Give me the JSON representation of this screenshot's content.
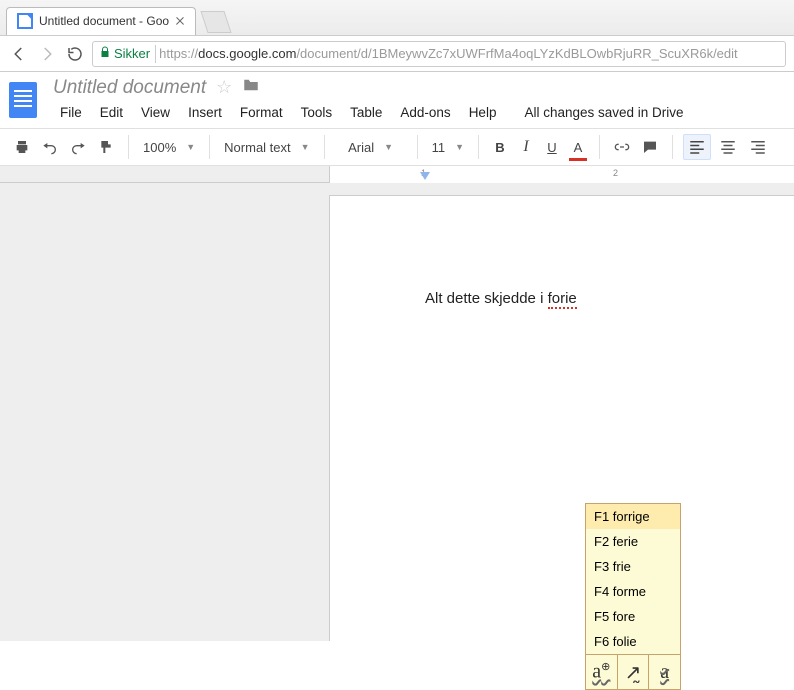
{
  "browser": {
    "tab_title": "Untitled document - Goo",
    "security_label": "Sikker",
    "url_prefix": "https://",
    "url_host": "docs.google.com",
    "url_path": "/document/d/1BMeywvZc7xUWFrfMa4oqLYzKdBLOwbRjuRR_ScuXR6k/edit"
  },
  "docs": {
    "title": "Untitled document",
    "save_state": "All changes saved in Drive",
    "menus": [
      "File",
      "Edit",
      "View",
      "Insert",
      "Format",
      "Tools",
      "Table",
      "Add-ons",
      "Help"
    ]
  },
  "toolbar": {
    "zoom": "100%",
    "style": "Normal text",
    "font": "Arial",
    "size": "11"
  },
  "document": {
    "text_prefix": "Alt dette skjedde i ",
    "text_error": "forie"
  },
  "suggestions": {
    "items": [
      {
        "key": "F1",
        "word": "forrige"
      },
      {
        "key": "F2",
        "word": "ferie"
      },
      {
        "key": "F3",
        "word": "frie"
      },
      {
        "key": "F4",
        "word": "forme"
      },
      {
        "key": "F5",
        "word": "fore"
      },
      {
        "key": "F6",
        "word": "folie"
      }
    ]
  }
}
